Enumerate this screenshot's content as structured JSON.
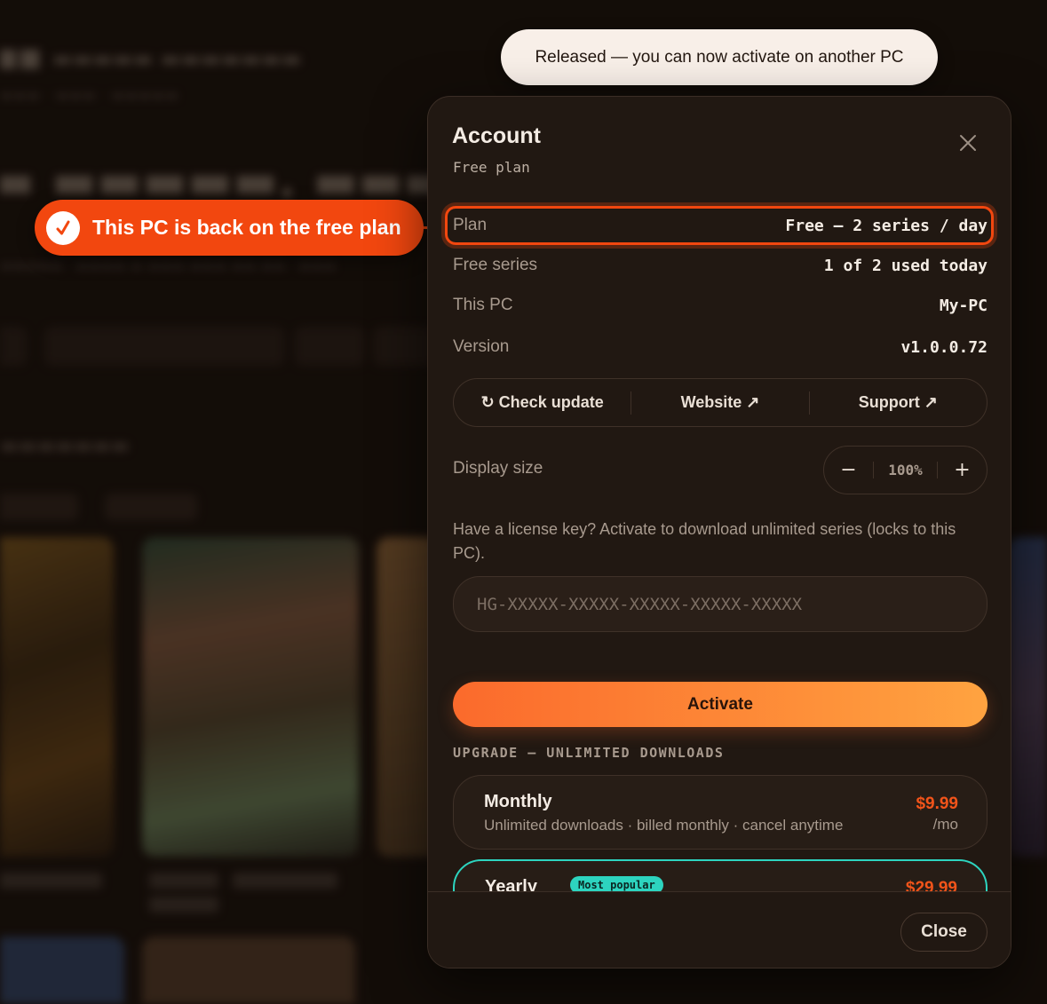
{
  "toast": {
    "message": "Released — you can now activate on another PC"
  },
  "callout": {
    "message": "This PC is back on the free plan"
  },
  "account": {
    "title": "Account",
    "subtitle": "Free plan",
    "rows": [
      {
        "label": "Plan",
        "value": "Free — 2 series / day"
      },
      {
        "label": "Free series",
        "value": "1 of 2 used today"
      },
      {
        "label": "This PC",
        "value": "My-PC"
      },
      {
        "label": "Version",
        "value": "v1.0.0.72"
      }
    ],
    "links": {
      "check_update": "↻ Check update",
      "website": "Website ↗",
      "support": "Support ↗"
    },
    "display_size": {
      "label": "Display size",
      "minus": "−",
      "value": "100%",
      "plus": "+"
    },
    "license": {
      "text": "Have a license key? Activate to download unlimited series (locks to this PC).",
      "placeholder": "HG-XXXXX-XXXXX-XXXXX-XXXXX-XXXXX",
      "activate_label": "Activate"
    },
    "upgrade": {
      "heading": "UPGRADE — UNLIMITED DOWNLOADS",
      "plans": [
        {
          "name": "Monthly",
          "desc": "Unlimited downloads · billed monthly · cancel anytime",
          "price": "$9.99",
          "per": "/mo"
        },
        {
          "name": "Yearly",
          "badge": "Most popular",
          "price": "$29.99"
        }
      ]
    },
    "close_label": "Close"
  },
  "colors": {
    "accent": "#f2470f",
    "teal": "#2dd4bf",
    "activate_start": "#fb6a2c",
    "activate_end": "#ffa340"
  }
}
